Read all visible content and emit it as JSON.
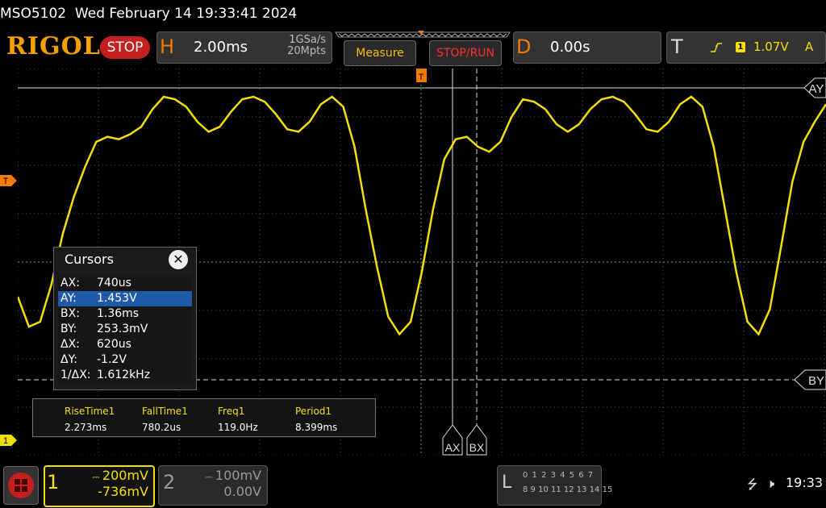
{
  "status": {
    "model": "MSO5102",
    "datetime": "Wed February 14 19:33:41 2024"
  },
  "toolbar": {
    "logo": "RIGOL",
    "run_state": "STOP",
    "horizontal": {
      "label": "H",
      "timebase": "2.00ms",
      "sample_rate": "1GSa/s",
      "memory_depth": "20Mpts"
    },
    "measure_label": "Measure",
    "stoprun_label": "STOP/RUN",
    "delay": {
      "label": "D",
      "value": "0.00s"
    },
    "trigger": {
      "label": "T",
      "source": "1",
      "level": "1.07V",
      "mode": "A",
      "icon": "rising-edge-icon"
    }
  },
  "markers": {
    "trigger_level": "T",
    "ch1_ground": "1",
    "ax": "AX",
    "bx": "BX",
    "ay": "AY",
    "by": "BY"
  },
  "cursors": {
    "title": "Cursors",
    "rows": [
      {
        "k": "AX:",
        "v": "740us"
      },
      {
        "k": "AY:",
        "v": "1.453V"
      },
      {
        "k": "BX:",
        "v": "1.36ms"
      },
      {
        "k": "BY:",
        "v": "253.3mV"
      },
      {
        "k": "ΔX:",
        "v": "620us"
      },
      {
        "k": "ΔY:",
        "v": "-1.2V"
      },
      {
        "k": "1/ΔX:",
        "v": "1.612kHz"
      }
    ],
    "selected_index": 1
  },
  "measurements": [
    {
      "name": "RiseTime1",
      "value": "2.273ms"
    },
    {
      "name": "FallTime1",
      "value": "780.2us"
    },
    {
      "name": "Freq1",
      "value": "119.0Hz"
    },
    {
      "name": "Period1",
      "value": "8.399ms"
    }
  ],
  "channels": {
    "ch1": {
      "num": "1",
      "scale": "200mV",
      "offset": "-736mV",
      "color": "#f4e000"
    },
    "ch2": {
      "num": "2",
      "scale": "100mV",
      "offset": "0.00V",
      "color": "#999999"
    }
  },
  "la": {
    "label": "L",
    "row1": "0 1 2 3  4 5 6 7",
    "row2": "8 9 10 11 12 13 14 15"
  },
  "system": {
    "time": "19:33",
    "usb_icon": "usb-icon",
    "speaker_icon": "speaker-muted-icon"
  },
  "waveform": {
    "color": "#f4e000",
    "samples": [
      0.2,
      0.08,
      0.1,
      0.25,
      0.45,
      0.6,
      0.72,
      0.82,
      0.84,
      0.83,
      0.85,
      0.88,
      0.95,
      1.0,
      0.99,
      0.96,
      0.9,
      0.86,
      0.88,
      0.94,
      0.99,
      1.0,
      0.98,
      0.93,
      0.87,
      0.86,
      0.9,
      0.97,
      1.0,
      0.96,
      0.8,
      0.55,
      0.32,
      0.12,
      0.05,
      0.1,
      0.3,
      0.55,
      0.75,
      0.83,
      0.84,
      0.8,
      0.78,
      0.82,
      0.92,
      0.99,
      0.98,
      0.95,
      0.89,
      0.86,
      0.89,
      0.95,
      0.99,
      1.0,
      0.98,
      0.93,
      0.87,
      0.86,
      0.9,
      0.97,
      1.0,
      0.96,
      0.8,
      0.55,
      0.3,
      0.1,
      0.05,
      0.15,
      0.4,
      0.66,
      0.82,
      0.9,
      0.97
    ]
  }
}
